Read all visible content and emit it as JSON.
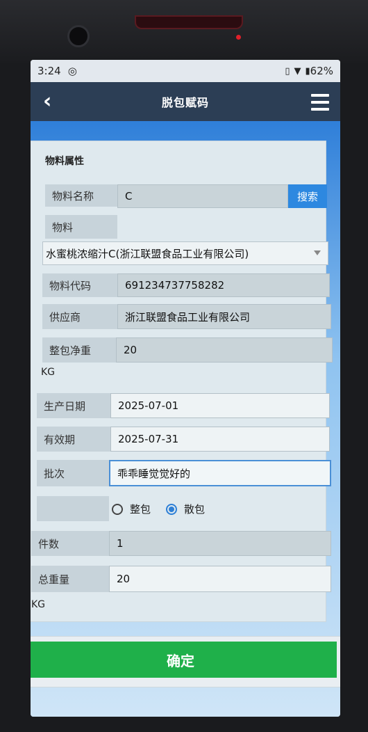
{
  "status": {
    "time": "3:24",
    "battery": "62%"
  },
  "header": {
    "title": "脱包赋码",
    "back_icon": "chevron-left-icon",
    "menu_icon": "menu-icon"
  },
  "section": {
    "title": "物料属性"
  },
  "form": {
    "material_name": {
      "label": "物料名称",
      "value": "C",
      "search_label": "搜索"
    },
    "material": {
      "label": "物料",
      "selected": "水蜜桃浓缩汁C(浙江联盟食品工业有限公司)"
    },
    "material_code": {
      "label": "物料代码",
      "value": "691234737758282"
    },
    "supplier": {
      "label": "供应商",
      "value": "浙江联盟食品工业有限公司"
    },
    "net_weight": {
      "label": "整包净重",
      "value": "20",
      "unit": "KG"
    },
    "production_date": {
      "label": "生产日期",
      "value": "2025-07-01"
    },
    "expiry_date": {
      "label": "有效期",
      "value": "2025-07-31"
    },
    "batch": {
      "label": "批次",
      "value": "乖乖睡觉觉好的"
    },
    "pack_type": {
      "options": [
        "整包",
        "散包"
      ],
      "selected": "散包"
    },
    "count": {
      "label": "件数",
      "value": "1"
    },
    "total_weight": {
      "label": "总重量",
      "value": "20",
      "unit": "KG"
    }
  },
  "actions": {
    "confirm_label": "确定"
  },
  "colors": {
    "appbar": "#2c3e55",
    "confirm": "#1fb04a",
    "search": "#2d88e0"
  }
}
